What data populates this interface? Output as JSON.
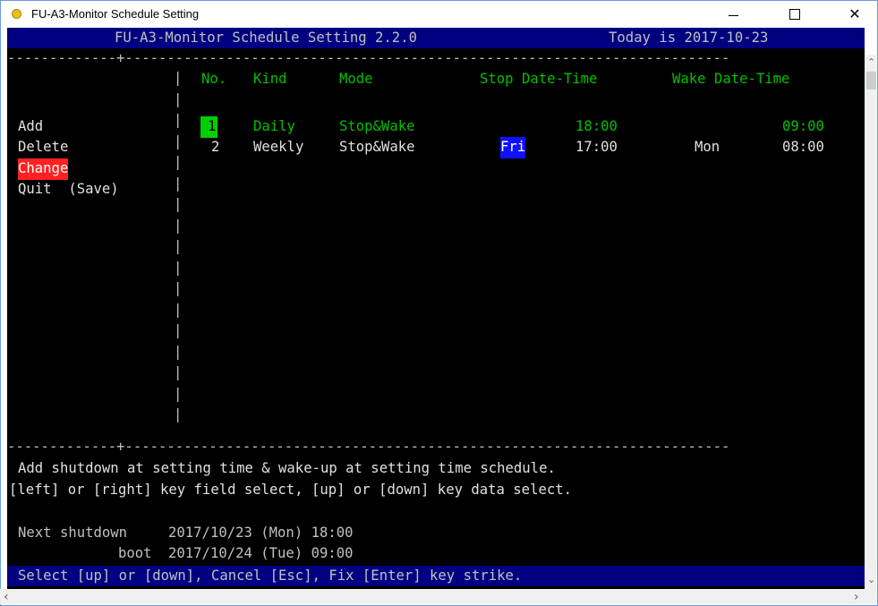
{
  "window": {
    "title": "FU-A3-Monitor Schedule Setting",
    "minimize_glyph": "—",
    "close_glyph": "✕"
  },
  "header": {
    "app_version": "FU-A3-Monitor Schedule Setting 2.2.0",
    "today": "Today is 2017-10-23"
  },
  "menu": {
    "items": [
      "Add",
      "Delete",
      "Change",
      "Quit  (Save)"
    ],
    "selected": "Change"
  },
  "table": {
    "columns": [
      "No.",
      "Kind",
      "Mode",
      "Stop Date-Time",
      "Wake Date-Time"
    ],
    "rows": [
      {
        "no": "1",
        "kind": "Daily",
        "mode": "Stop&Wake",
        "stop_day": "",
        "stop_time": "18:00",
        "wake_day": "",
        "wake_time": "09:00"
      },
      {
        "no": "2",
        "kind": "Weekly",
        "mode": "Stop&Wake",
        "stop_day": "Fri",
        "stop_time": "17:00",
        "wake_day": "Mon",
        "wake_time": "08:00"
      }
    ]
  },
  "help": {
    "line1": "Add shutdown at setting time & wake-up at setting time schedule.",
    "line2": "[left] or [right] key field select, [up] or [down] key data select."
  },
  "next": {
    "shutdown_label": "Next shutdown",
    "shutdown_value": "2017/10/23 (Mon) 18:00",
    "boot_label": "boot",
    "boot_value": "2017/10/24 (Tue) 09:00"
  },
  "footer": {
    "text": "Select [up] or [down], Cancel [Esc], Fix [Enter] key strike."
  },
  "colors": {
    "console_bg": "#000000",
    "header_bg": "#000080",
    "text_green": "#00c000",
    "highlight_red": "#ff2020",
    "highlight_blue": "#1010ff",
    "highlight_green": "#00d000"
  }
}
